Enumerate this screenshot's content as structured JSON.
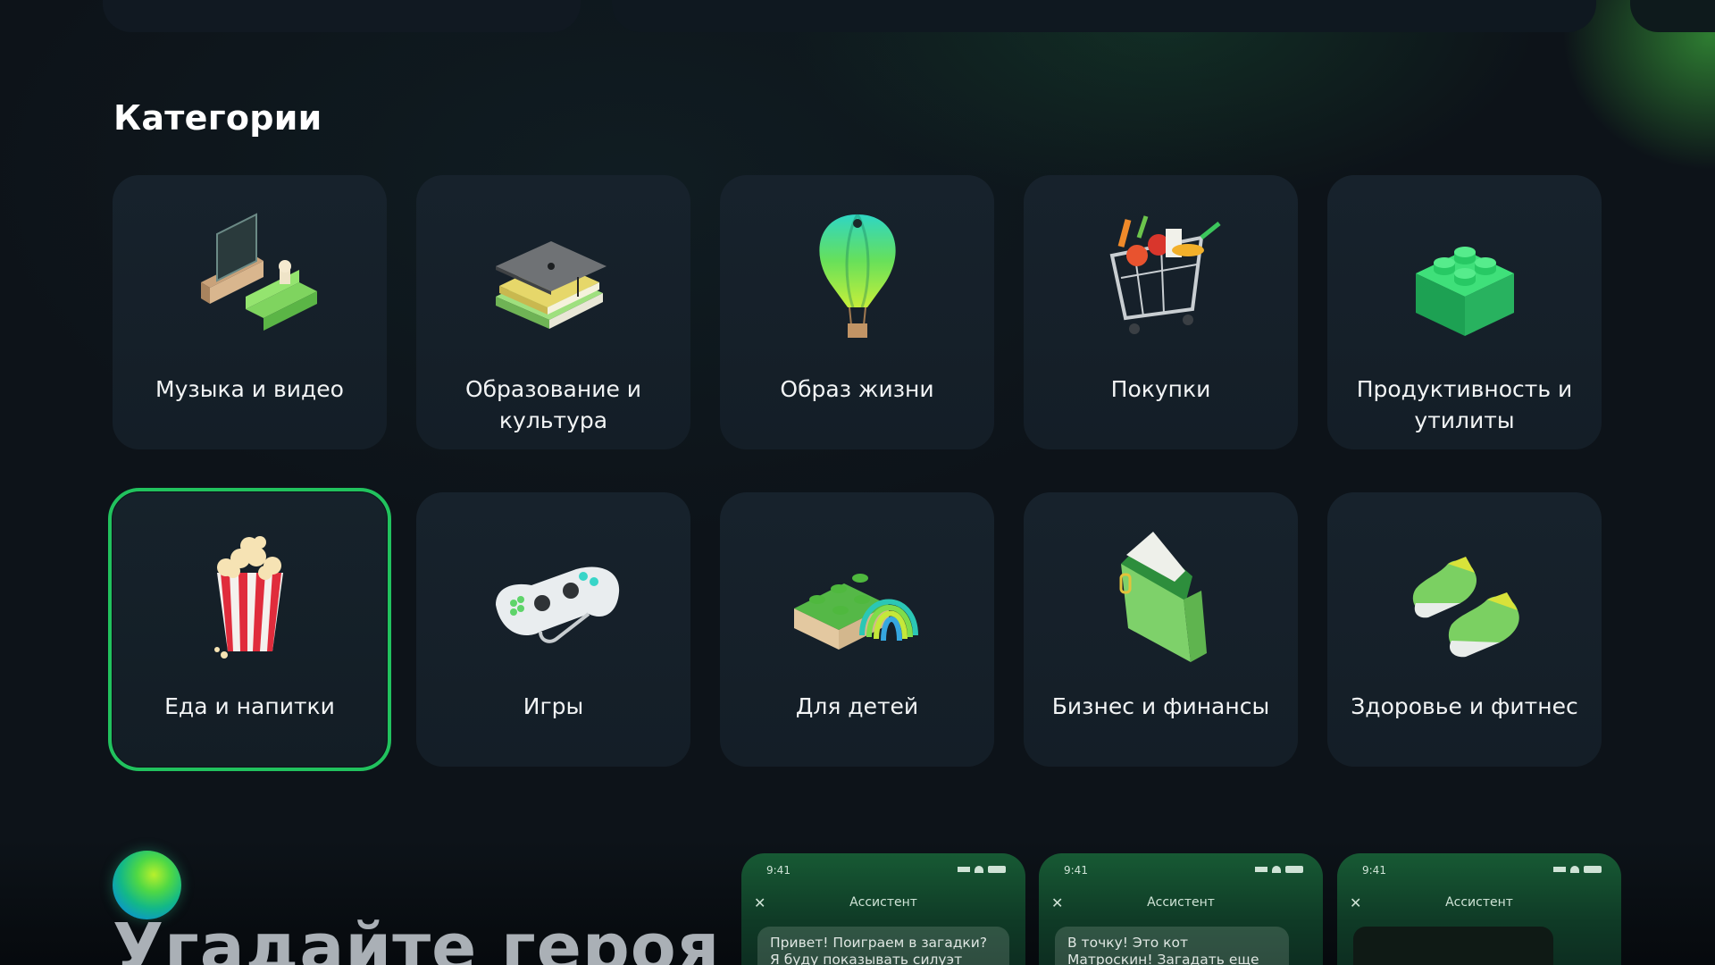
{
  "page": {
    "section_title": "Категории"
  },
  "categories": [
    {
      "label": "Музыка и видео",
      "icon": "tv-sofa-icon"
    },
    {
      "label": "Образование и культура",
      "icon": "books-graduation-cap-icon"
    },
    {
      "label": "Образ жизни",
      "icon": "hot-air-balloon-icon"
    },
    {
      "label": "Покупки",
      "icon": "shopping-cart-icon"
    },
    {
      "label": "Продуктивность и утилиты",
      "icon": "building-brick-icon"
    },
    {
      "label": "Еда и напитки",
      "icon": "popcorn-icon",
      "selected": true
    },
    {
      "label": "Игры",
      "icon": "gamepad-icon"
    },
    {
      "label": "Для детей",
      "icon": "toy-brick-slinky-icon"
    },
    {
      "label": "Бизнес и финансы",
      "icon": "wallet-icon"
    },
    {
      "label": "Здоровье и фитнес",
      "icon": "sneakers-icon"
    }
  ],
  "promo": {
    "title": "Угадайте героя",
    "phones": [
      {
        "time": "9:41",
        "title": "Ассистент",
        "message": "Привет! Поиграем в загадки? Я буду показывать силуэт героя"
      },
      {
        "time": "9:41",
        "title": "Ассистент",
        "message": "В точку! Это кот Матроскин! Загадать еще героя?"
      },
      {
        "time": "9:41",
        "title": "Ассистент",
        "message": ""
      }
    ]
  },
  "colors": {
    "accent": "#21c25e",
    "background": "#0d1319",
    "tile": "#17222c"
  }
}
